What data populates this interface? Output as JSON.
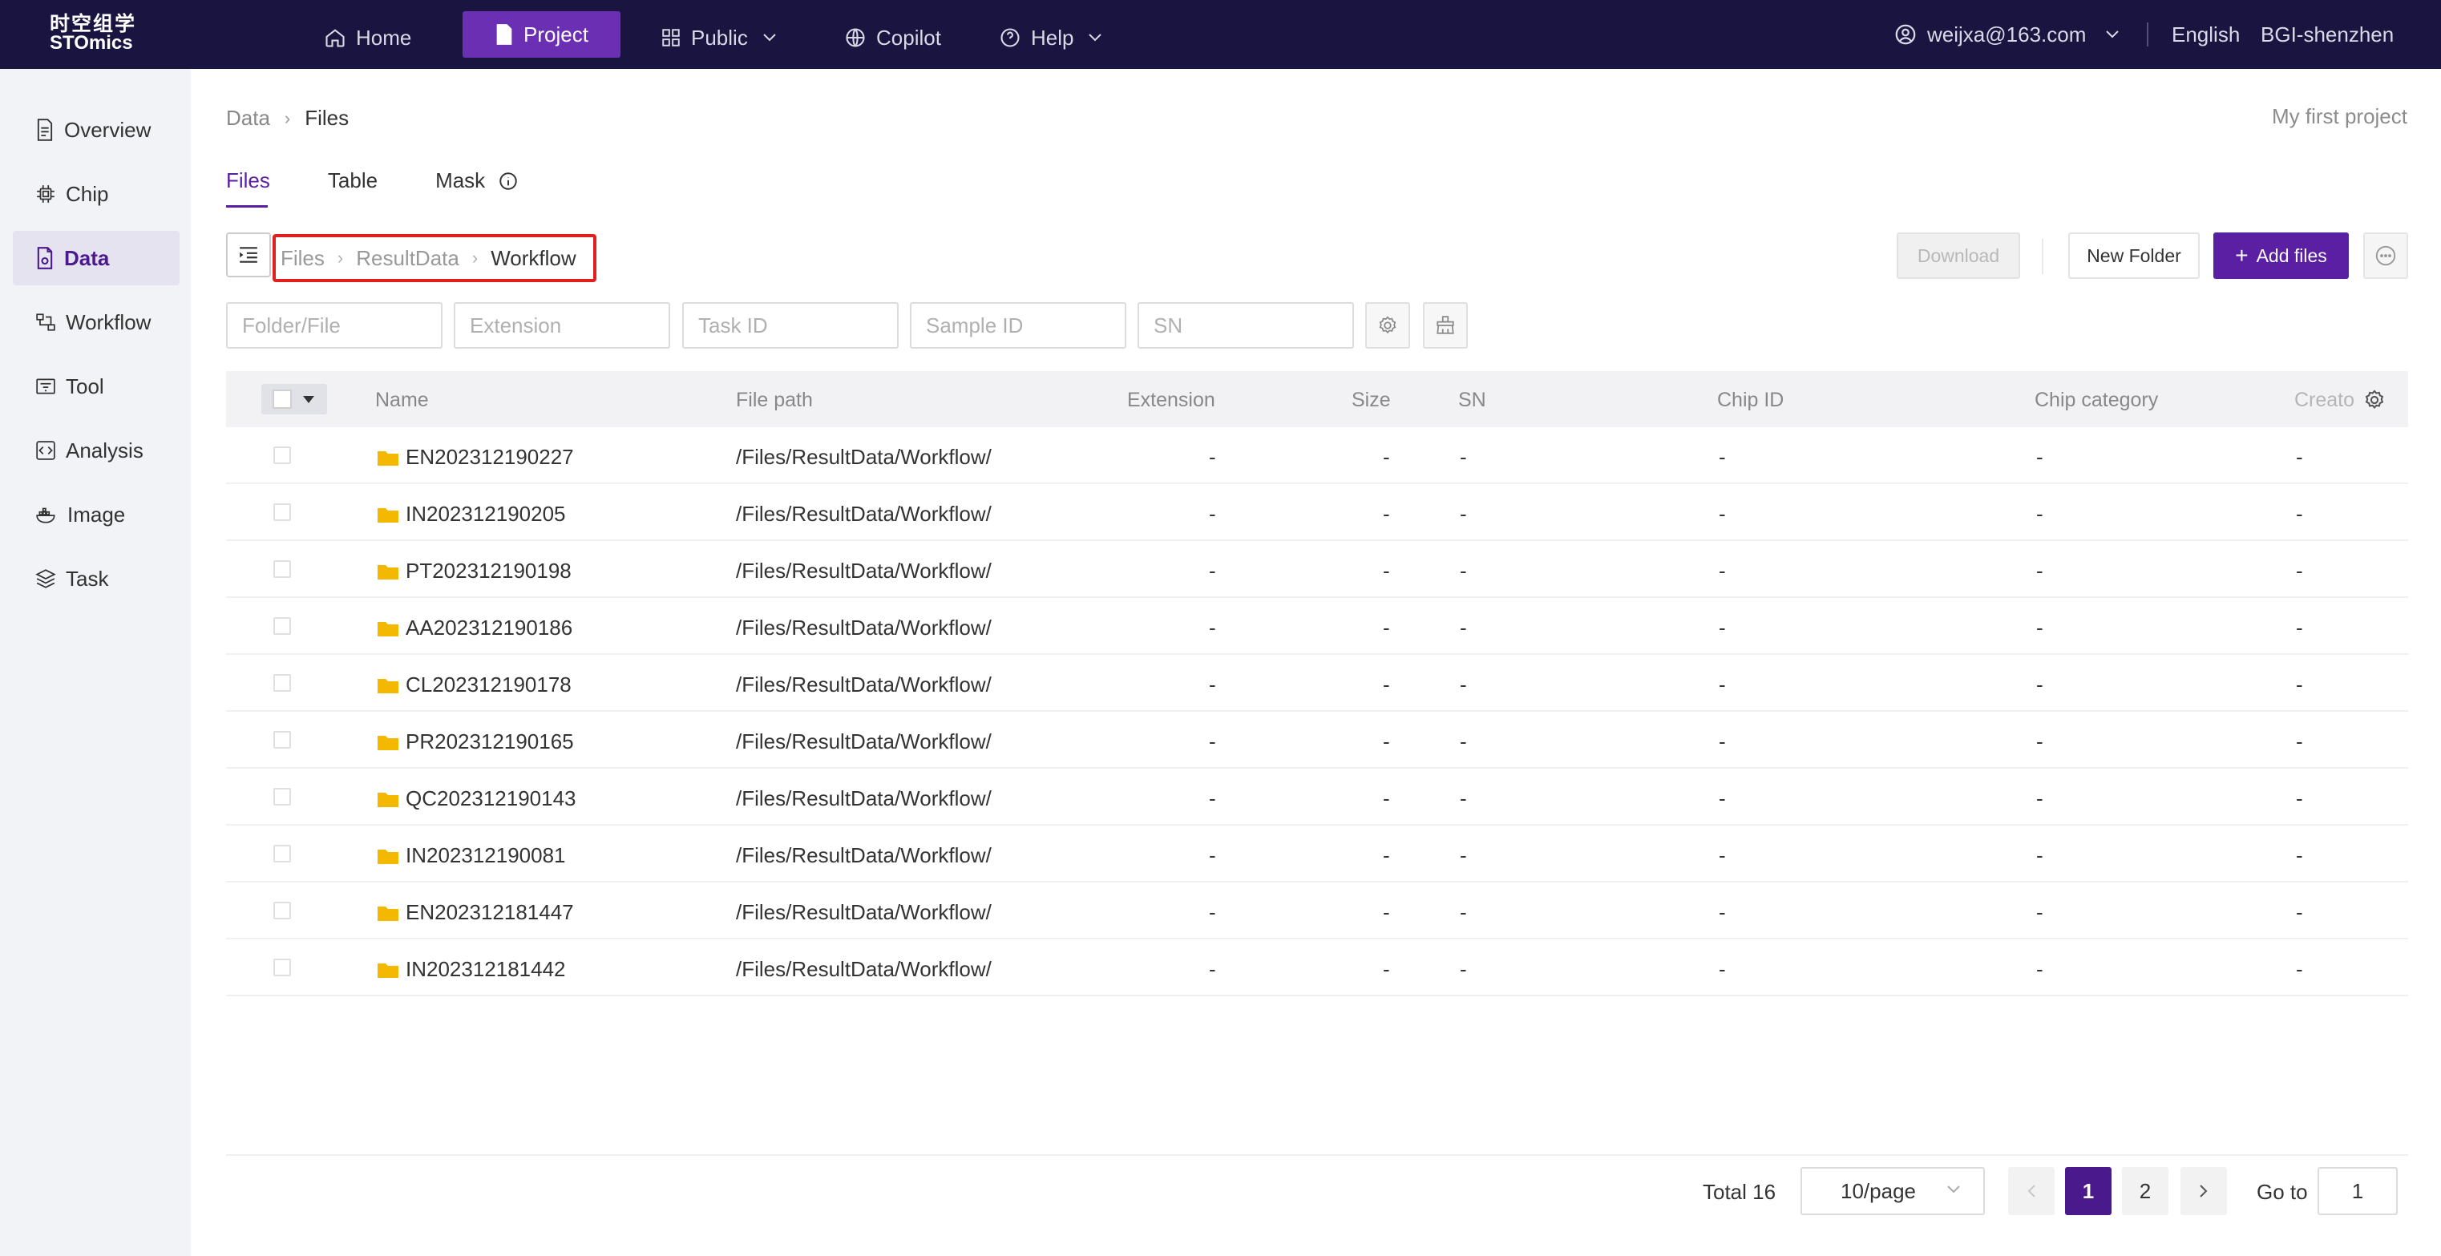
{
  "header": {
    "logo_cn": "时空组学",
    "logo_en": "STOmics",
    "nav": {
      "home": "Home",
      "project": "Project",
      "public": "Public",
      "copilot": "Copilot",
      "help": "Help"
    },
    "user": "weijxa@163.com",
    "language": "English",
    "region": "BGI-shenzhen"
  },
  "sidebar": {
    "items": [
      {
        "label": "Overview",
        "icon": "document-icon"
      },
      {
        "label": "Chip",
        "icon": "chip-icon"
      },
      {
        "label": "Data",
        "icon": "data-file-icon",
        "active": true
      },
      {
        "label": "Workflow",
        "icon": "workflow-icon"
      },
      {
        "label": "Tool",
        "icon": "tool-icon"
      },
      {
        "label": "Analysis",
        "icon": "code-icon"
      },
      {
        "label": "Image",
        "icon": "docker-icon"
      },
      {
        "label": "Task",
        "icon": "layers-icon"
      }
    ]
  },
  "breadcrumb": {
    "parent": "Data",
    "current": "Files"
  },
  "project_name": "My first project",
  "tabs": {
    "files": "Files",
    "table": "Table",
    "mask": "Mask"
  },
  "path": {
    "root": "Files",
    "mid": "ResultData",
    "current": "Workflow"
  },
  "toolbar": {
    "download": "Download",
    "new_folder": "New Folder",
    "add_files": "Add files"
  },
  "filters": {
    "folder_file": "Folder/File",
    "extension": "Extension",
    "task_id": "Task ID",
    "sample_id": "Sample ID",
    "sn": "SN"
  },
  "table": {
    "headers": {
      "name": "Name",
      "file_path": "File path",
      "extension": "Extension",
      "size": "Size",
      "sn": "SN",
      "chip_id": "Chip ID",
      "chip_category": "Chip category",
      "creator": "Creato"
    },
    "rows": [
      {
        "name": "EN202312190227",
        "path": "/Files/ResultData/Workflow/",
        "ext": "-",
        "size": "-",
        "sn": "-",
        "chip_id": "-",
        "chip_cat": "-",
        "creator": "-"
      },
      {
        "name": "IN202312190205",
        "path": "/Files/ResultData/Workflow/",
        "ext": "-",
        "size": "-",
        "sn": "-",
        "chip_id": "-",
        "chip_cat": "-",
        "creator": "-"
      },
      {
        "name": "PT202312190198",
        "path": "/Files/ResultData/Workflow/",
        "ext": "-",
        "size": "-",
        "sn": "-",
        "chip_id": "-",
        "chip_cat": "-",
        "creator": "-"
      },
      {
        "name": "AA202312190186",
        "path": "/Files/ResultData/Workflow/",
        "ext": "-",
        "size": "-",
        "sn": "-",
        "chip_id": "-",
        "chip_cat": "-",
        "creator": "-"
      },
      {
        "name": "CL202312190178",
        "path": "/Files/ResultData/Workflow/",
        "ext": "-",
        "size": "-",
        "sn": "-",
        "chip_id": "-",
        "chip_cat": "-",
        "creator": "-"
      },
      {
        "name": "PR202312190165",
        "path": "/Files/ResultData/Workflow/",
        "ext": "-",
        "size": "-",
        "sn": "-",
        "chip_id": "-",
        "chip_cat": "-",
        "creator": "-"
      },
      {
        "name": "QC202312190143",
        "path": "/Files/ResultData/Workflow/",
        "ext": "-",
        "size": "-",
        "sn": "-",
        "chip_id": "-",
        "chip_cat": "-",
        "creator": "-"
      },
      {
        "name": "IN202312190081",
        "path": "/Files/ResultData/Workflow/",
        "ext": "-",
        "size": "-",
        "sn": "-",
        "chip_id": "-",
        "chip_cat": "-",
        "creator": "-"
      },
      {
        "name": "EN202312181447",
        "path": "/Files/ResultData/Workflow/",
        "ext": "-",
        "size": "-",
        "sn": "-",
        "chip_id": "-",
        "chip_cat": "-",
        "creator": "-"
      },
      {
        "name": "IN202312181442",
        "path": "/Files/ResultData/Workflow/",
        "ext": "-",
        "size": "-",
        "sn": "-",
        "chip_id": "-",
        "chip_cat": "-",
        "creator": "-"
      }
    ]
  },
  "pagination": {
    "total": "Total 16",
    "page_size": "10/page",
    "pages": [
      "1",
      "2"
    ],
    "current_page": "1",
    "goto_label": "Go to",
    "goto_value": "1"
  },
  "colors": {
    "topbar": "#1a1440",
    "accent": "#5b1fa4",
    "highlight_border": "#e0201e",
    "folder": "#f5b800"
  }
}
